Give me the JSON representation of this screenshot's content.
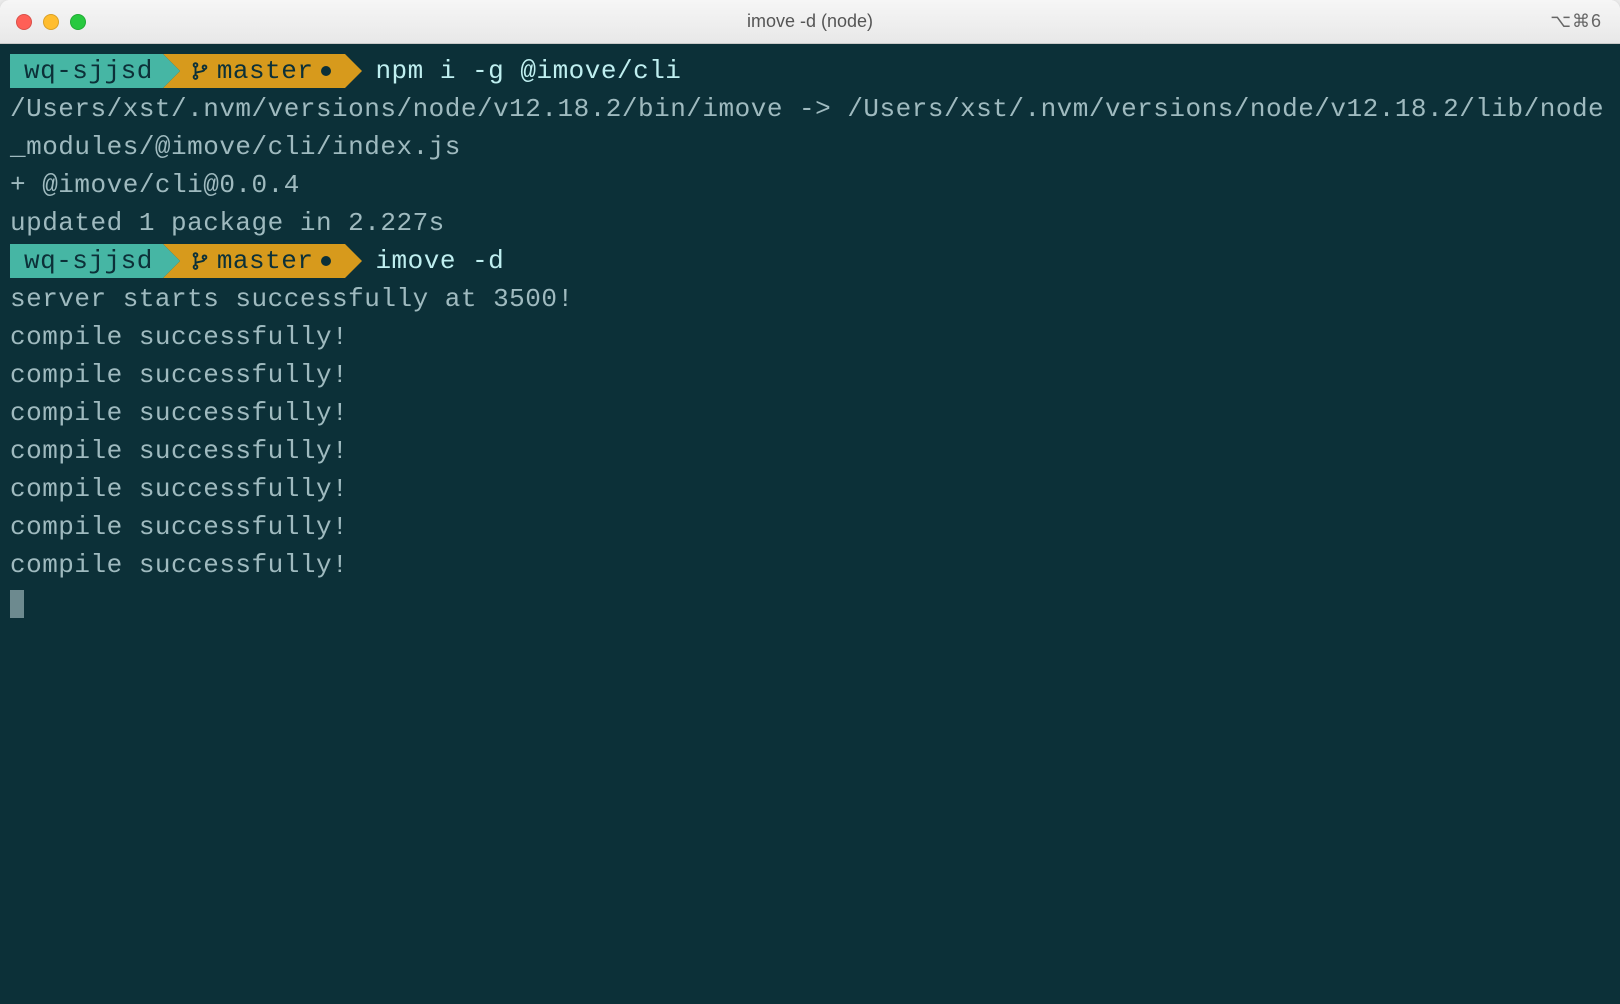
{
  "titlebar": {
    "title": "imove -d (node)",
    "shortcut": "⌥⌘6"
  },
  "prompts": [
    {
      "dir": "wq-sjjsd",
      "branch": "master",
      "command": "npm i -g @imove/cli"
    },
    {
      "dir": "wq-sjjsd",
      "branch": "master",
      "command": "imove -d"
    }
  ],
  "output1": [
    "/Users/xst/.nvm/versions/node/v12.18.2/bin/imove -> /Users/xst/.nvm/versions/node/v12.18.2/lib/node_modules/@imove/cli/index.js",
    "+ @imove/cli@0.0.4",
    "updated 1 package in 2.227s"
  ],
  "output2": [
    "server starts successfully at 3500!",
    "compile successfully!",
    "compile successfully!",
    "compile successfully!",
    "compile successfully!",
    "compile successfully!",
    "compile successfully!",
    "compile successfully!"
  ]
}
